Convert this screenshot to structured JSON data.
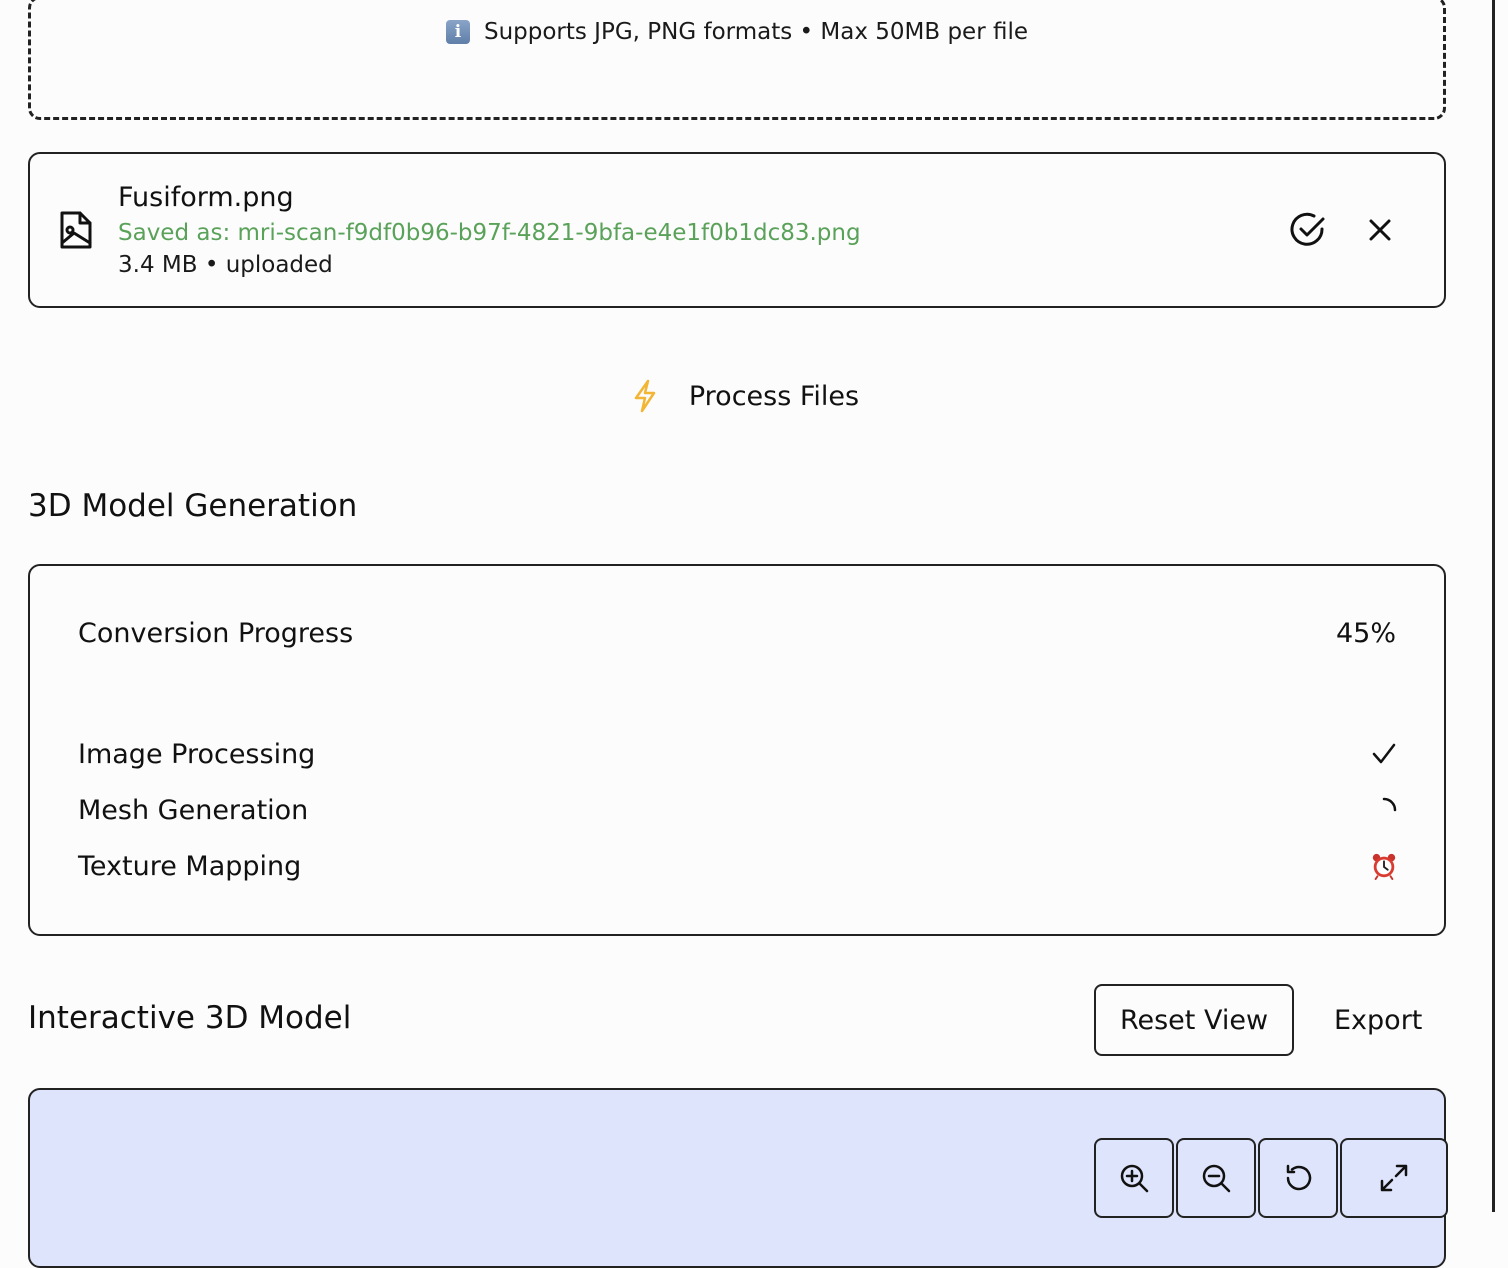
{
  "upload": {
    "hint": "Supports JPG, PNG formats • Max 50MB per file",
    "hint_icon": "info-icon"
  },
  "file": {
    "name": "Fusiform.png",
    "saved_as": "Saved as: mri-scan-f9df0b96-b97f-4821-9bfa-e4e1f0b1dc83.png",
    "meta": "3.4 MB • uploaded",
    "status_icon": "check-circle-icon",
    "saved_color": "#5aa25a"
  },
  "process": {
    "label": "Process Files",
    "icon": "bolt-icon",
    "icon_color": "#f2b534"
  },
  "generation": {
    "title": "3D Model Generation",
    "progress_label": "Conversion Progress",
    "progress_text": "45%",
    "progress_percent": 45,
    "steps": [
      {
        "label": "Image Processing",
        "status": "done"
      },
      {
        "label": "Mesh Generation",
        "status": "in-progress"
      },
      {
        "label": "Texture Mapping",
        "status": "pending"
      }
    ]
  },
  "viewer": {
    "title": "Interactive 3D Model",
    "reset_label": "Reset View",
    "export_label": "Export",
    "background": "#dee4fb",
    "controls": [
      "zoom-in-icon",
      "zoom-out-icon",
      "rotate-icon",
      "fullscreen-icon"
    ]
  }
}
